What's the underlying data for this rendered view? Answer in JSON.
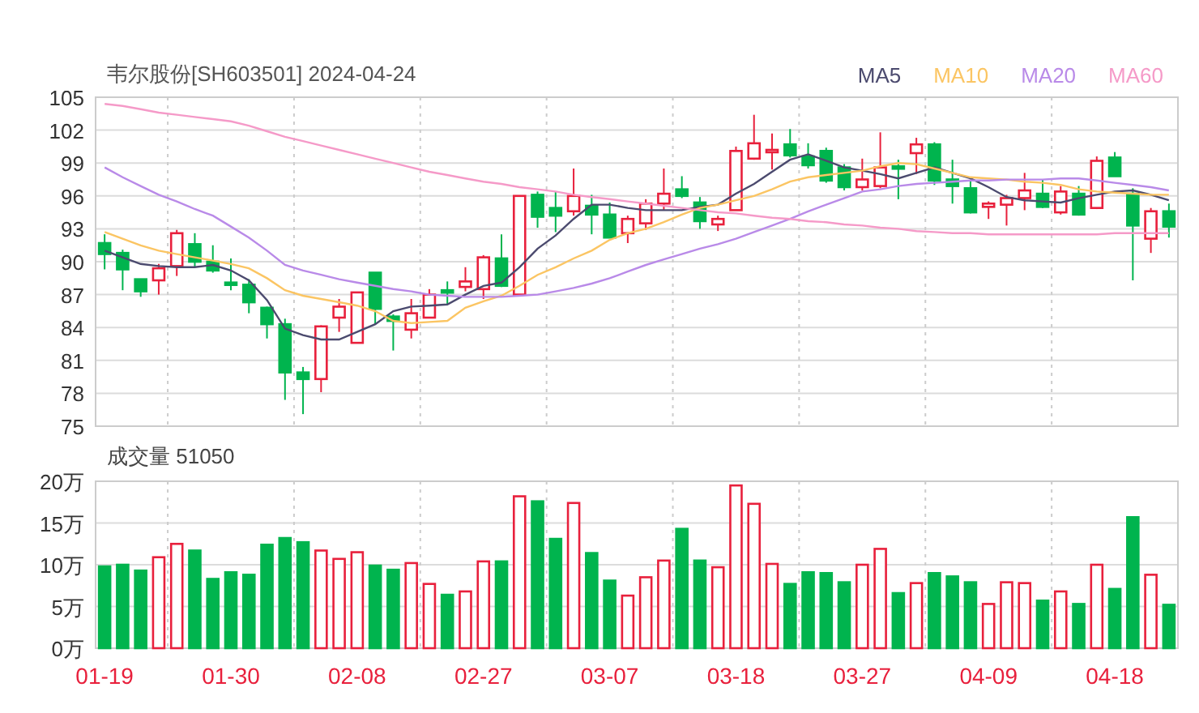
{
  "title": "韦尔股份[SH603501] 2024-04-24",
  "price_chart": {
    "chart_data": {
      "type": "candlestick",
      "grid": true,
      "ylim": [
        75,
        105
      ],
      "yticks": [
        75,
        78,
        81,
        84,
        87,
        90,
        93,
        96,
        99,
        102,
        105
      ],
      "categories": [
        null,
        null,
        null,
        null,
        null,
        null,
        null,
        null,
        null,
        null,
        null,
        null,
        null,
        null,
        null,
        null,
        null,
        null,
        null,
        null,
        null,
        null,
        null,
        null,
        null,
        null,
        null,
        null,
        null,
        null,
        null,
        null,
        null,
        null,
        null,
        null,
        null,
        null,
        null,
        null,
        null,
        null,
        null,
        null,
        null,
        null,
        null,
        null,
        null,
        null,
        null,
        null,
        null,
        null,
        null,
        null,
        null,
        null,
        null,
        null
      ],
      "ohlc": [
        [
          91.7,
          92.5,
          89.3,
          90.7
        ],
        [
          90.8,
          91.1,
          87.4,
          89.3
        ],
        [
          88.4,
          88.4,
          86.8,
          87.3
        ],
        [
          88.3,
          89.8,
          87.0,
          89.4
        ],
        [
          89.6,
          92.9,
          88.7,
          92.6
        ],
        [
          91.6,
          92.6,
          89.5,
          90.0
        ],
        [
          90.0,
          91.5,
          89.0,
          89.2
        ],
        [
          88.1,
          90.3,
          87.4,
          87.9
        ],
        [
          87.9,
          88.4,
          85.3,
          86.3
        ],
        [
          85.8,
          85.9,
          83.0,
          84.3
        ],
        [
          84.3,
          84.8,
          77.4,
          79.9
        ],
        [
          79.9,
          80.4,
          76.1,
          79.3
        ],
        [
          79.3,
          84.2,
          78.1,
          84.1
        ],
        [
          84.9,
          86.6,
          83.6,
          85.9
        ],
        [
          82.6,
          87.2,
          82.6,
          87.2
        ],
        [
          89.0,
          89.0,
          84.3,
          85.7
        ],
        [
          85.0,
          85.2,
          81.9,
          84.6
        ],
        [
          83.8,
          86.6,
          83.0,
          85.3
        ],
        [
          84.9,
          87.5,
          84.9,
          87.0
        ],
        [
          87.4,
          88.2,
          86.1,
          87.3
        ],
        [
          87.7,
          89.5,
          87.3,
          88.2
        ],
        [
          87.5,
          90.6,
          86.6,
          90.4
        ],
        [
          90.3,
          92.5,
          87.7,
          87.8
        ],
        [
          87.0,
          96.0,
          87.0,
          96.0
        ],
        [
          96.1,
          96.4,
          93.1,
          94.1
        ],
        [
          94.9,
          96.4,
          92.7,
          94.2
        ],
        [
          94.6,
          98.5,
          94.2,
          96.0
        ],
        [
          95.1,
          96.1,
          92.5,
          94.3
        ],
        [
          94.3,
          95.4,
          92.2,
          92.2
        ],
        [
          92.6,
          94.2,
          91.7,
          93.9
        ],
        [
          93.5,
          95.7,
          92.9,
          95.3
        ],
        [
          95.3,
          98.5,
          94.7,
          96.2
        ],
        [
          96.6,
          97.8,
          95.8,
          96.0
        ],
        [
          95.4,
          95.9,
          93.0,
          93.7
        ],
        [
          93.4,
          94.2,
          92.8,
          93.9
        ],
        [
          94.7,
          100.5,
          94.7,
          100.1
        ],
        [
          99.4,
          103.4,
          99.3,
          100.8
        ],
        [
          100.0,
          101.7,
          98.4,
          100.2
        ],
        [
          100.7,
          102.1,
          99.5,
          99.7
        ],
        [
          99.6,
          100.8,
          98.5,
          98.8
        ],
        [
          100.1,
          100.4,
          97.2,
          97.4
        ],
        [
          98.6,
          98.9,
          96.5,
          96.8
        ],
        [
          96.8,
          99.4,
          96.5,
          97.5
        ],
        [
          96.9,
          101.8,
          96.7,
          98.6
        ],
        [
          98.7,
          99.3,
          95.7,
          98.5
        ],
        [
          99.9,
          101.3,
          98.0,
          100.7
        ],
        [
          100.7,
          100.9,
          97.0,
          97.4
        ],
        [
          97.5,
          99.3,
          95.3,
          96.9
        ],
        [
          96.7,
          97.5,
          94.4,
          94.5
        ],
        [
          95.0,
          95.5,
          93.9,
          95.3
        ],
        [
          95.2,
          96.1,
          93.3,
          95.8
        ],
        [
          95.8,
          98.1,
          94.7,
          96.5
        ],
        [
          96.2,
          97.5,
          94.9,
          95.0
        ],
        [
          94.5,
          96.9,
          94.3,
          96.4
        ],
        [
          96.2,
          96.9,
          94.2,
          94.3
        ],
        [
          94.9,
          99.6,
          94.8,
          99.2
        ],
        [
          99.5,
          100.0,
          97.8,
          97.8
        ],
        [
          96.2,
          96.7,
          88.3,
          93.3
        ],
        [
          92.1,
          94.9,
          90.8,
          94.6
        ],
        [
          94.6,
          95.3,
          92.2,
          93.2
        ]
      ]
    },
    "moving_averages": {
      "chart_data": {
        "type": "line",
        "ylim": [
          75,
          105
        ],
        "categories": [
          null,
          null,
          null,
          null,
          null,
          null,
          null,
          null,
          null,
          null,
          null,
          null,
          null,
          null,
          null,
          null,
          null,
          null,
          null,
          null,
          null,
          null,
          null,
          null,
          null,
          null,
          null,
          null,
          null,
          null,
          null,
          null,
          null,
          null,
          null,
          null,
          null,
          null,
          null,
          null,
          null,
          null,
          null,
          null,
          null,
          null,
          null,
          null,
          null,
          null,
          null,
          null,
          null,
          null,
          null,
          null,
          null,
          null,
          null,
          null
        ],
        "series": [
          {
            "name": "MA5",
            "color": "#4b4a6e",
            "values": [
              91.0,
              90.4,
              89.8,
              89.6,
              89.5,
              89.5,
              89.7,
              89.2,
              88.3,
              86.5,
              83.9,
              83.3,
              82.9,
              82.9,
              83.6,
              84.3,
              85.5,
              85.9,
              86.0,
              86.1,
              87.0,
              87.8,
              88.1,
              89.5,
              91.2,
              92.4,
              93.9,
              95.2,
              95.2,
              94.9,
              94.7,
              94.7,
              94.7,
              95.0,
              95.2,
              96.2,
              97.1,
              98.2,
              99.3,
              99.8,
              99.2,
              98.6,
              98.3,
              98.0,
              97.6,
              98.1,
              98.6,
              98.1,
              97.6,
              96.8,
              95.9,
              95.6,
              95.5,
              95.4,
              95.8,
              96.1,
              96.4,
              96.5,
              96.1,
              95.6
            ]
          },
          {
            "name": "MA10",
            "color": "#fbc563",
            "values": [
              92.7,
              92.1,
              91.5,
              91.0,
              90.7,
              90.4,
              90.1,
              89.8,
              89.4,
              88.5,
              87.4,
              86.9,
              86.6,
              86.3,
              86.0,
              85.5,
              84.6,
              84.4,
              84.5,
              84.6,
              85.8,
              86.4,
              86.9,
              87.8,
              88.8,
              89.5,
              90.3,
              91.0,
              92.0,
              92.6,
              93.0,
              93.6,
              94.3,
              94.9,
              95.2,
              95.6,
              96.0,
              96.6,
              97.3,
              97.7,
              97.9,
              98.1,
              98.3,
              98.7,
              99.0,
              98.9,
              98.5,
              98.1,
              97.7,
              97.6,
              97.5,
              97.3,
              97.2,
              97.0,
              96.6,
              96.4,
              96.3,
              96.2,
              96.1,
              96.1
            ]
          },
          {
            "name": "MA20",
            "color": "#b98ae8",
            "values": [
              98.6,
              97.7,
              96.9,
              96.1,
              95.5,
              94.8,
              94.2,
              93.2,
              92.2,
              91.0,
              89.7,
              89.2,
              88.8,
              88.4,
              88.1,
              87.8,
              87.5,
              87.3,
              87.0,
              86.9,
              86.8,
              86.8,
              86.8,
              86.9,
              87.0,
              87.3,
              87.6,
              88.0,
              88.5,
              89.1,
              89.7,
              90.2,
              90.7,
              91.2,
              91.6,
              92.1,
              92.7,
              93.3,
              93.9,
              94.6,
              95.2,
              95.8,
              96.4,
              96.6,
              96.9,
              97.1,
              97.2,
              97.3,
              97.4,
              97.4,
              97.5,
              97.5,
              97.5,
              97.6,
              97.6,
              97.4,
              97.2,
              97.0,
              96.8,
              96.5
            ]
          },
          {
            "name": "MA60",
            "color": "#f59ac8",
            "values": [
              104.4,
              104.2,
              103.9,
              103.6,
              103.4,
              103.2,
              103.0,
              102.8,
              102.4,
              101.9,
              101.4,
              101.0,
              100.6,
              100.2,
              99.8,
              99.4,
              99.0,
              98.6,
              98.2,
              97.9,
              97.6,
              97.3,
              97.1,
              96.8,
              96.6,
              96.4,
              96.1,
              95.9,
              95.7,
              95.5,
              95.3,
              95.1,
              94.9,
              94.7,
              94.5,
              94.4,
              94.2,
              94.0,
              93.9,
              93.7,
              93.6,
              93.4,
              93.3,
              93.1,
              93.0,
              92.8,
              92.7,
              92.6,
              92.6,
              92.5,
              92.5,
              92.5,
              92.5,
              92.5,
              92.5,
              92.5,
              92.6,
              92.6,
              92.6,
              92.6
            ]
          }
        ]
      }
    }
  },
  "volume_chart": {
    "label": "成交量 51050",
    "chart_data": {
      "type": "bar",
      "grid": true,
      "ylim": [
        0,
        20
      ],
      "yticks": [
        {
          "value": 0,
          "label": "0万"
        },
        {
          "value": 5,
          "label": "5万"
        },
        {
          "value": 10,
          "label": "10万"
        },
        {
          "value": 15,
          "label": "15万"
        },
        {
          "value": 20,
          "label": "20万"
        }
      ],
      "categories": [
        "01-19",
        null,
        null,
        null,
        null,
        null,
        null,
        "01-30",
        null,
        null,
        null,
        null,
        null,
        null,
        "02-08",
        null,
        null,
        null,
        null,
        null,
        null,
        "02-27",
        null,
        null,
        null,
        null,
        null,
        null,
        "03-07",
        null,
        null,
        null,
        null,
        null,
        null,
        "03-18",
        null,
        null,
        null,
        null,
        null,
        null,
        "03-27",
        null,
        null,
        null,
        null,
        null,
        null,
        "04-09",
        null,
        null,
        null,
        null,
        null,
        null,
        "04-18",
        null,
        null,
        null
      ],
      "values": [
        9.8,
        10.0,
        9.3,
        10.9,
        12.5,
        11.7,
        8.3,
        9.1,
        8.8,
        12.4,
        13.2,
        12.7,
        11.7,
        10.7,
        11.5,
        9.9,
        9.4,
        10.2,
        7.7,
        6.4,
        6.8,
        10.4,
        10.4,
        18.2,
        17.6,
        13.1,
        17.4,
        11.4,
        8.1,
        6.3,
        8.5,
        10.5,
        14.3,
        10.5,
        9.7,
        19.5,
        17.3,
        10.1,
        7.7,
        9.1,
        9.0,
        7.9,
        10.0,
        11.9,
        6.6,
        7.8,
        9.0,
        8.6,
        7.9,
        5.3,
        7.9,
        7.8,
        5.7,
        6.8,
        5.3,
        10.0,
        7.1,
        15.7,
        8.8,
        5.2
      ]
    }
  }
}
